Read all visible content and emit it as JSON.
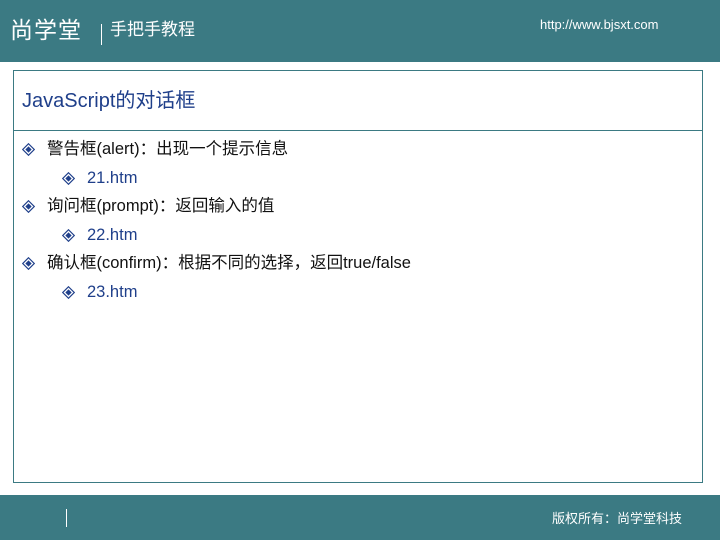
{
  "header": {
    "brand": "尚学堂",
    "tagline": "手把手教程",
    "url": "http://www.bjsxt.com"
  },
  "slide": {
    "title": "JavaScript的对话框",
    "bullets": [
      {
        "level": 1,
        "text": "警告框(alert)：出现一个提示信息"
      },
      {
        "level": 2,
        "text": "21.htm"
      },
      {
        "level": 1,
        "text": "询问框(prompt)：返回输入的值"
      },
      {
        "level": 2,
        "text": "22.htm"
      },
      {
        "level": 1,
        "text": "确认框(confirm)：根据不同的选择，返回true/false"
      },
      {
        "level": 2,
        "text": "23.htm"
      }
    ]
  },
  "footer": {
    "copyright": "版权所有：尚学堂科技"
  },
  "colors": {
    "theme": "#3b7a83",
    "title_text": "#1f3f8a",
    "bullet_icon": "#1f3f8a"
  }
}
